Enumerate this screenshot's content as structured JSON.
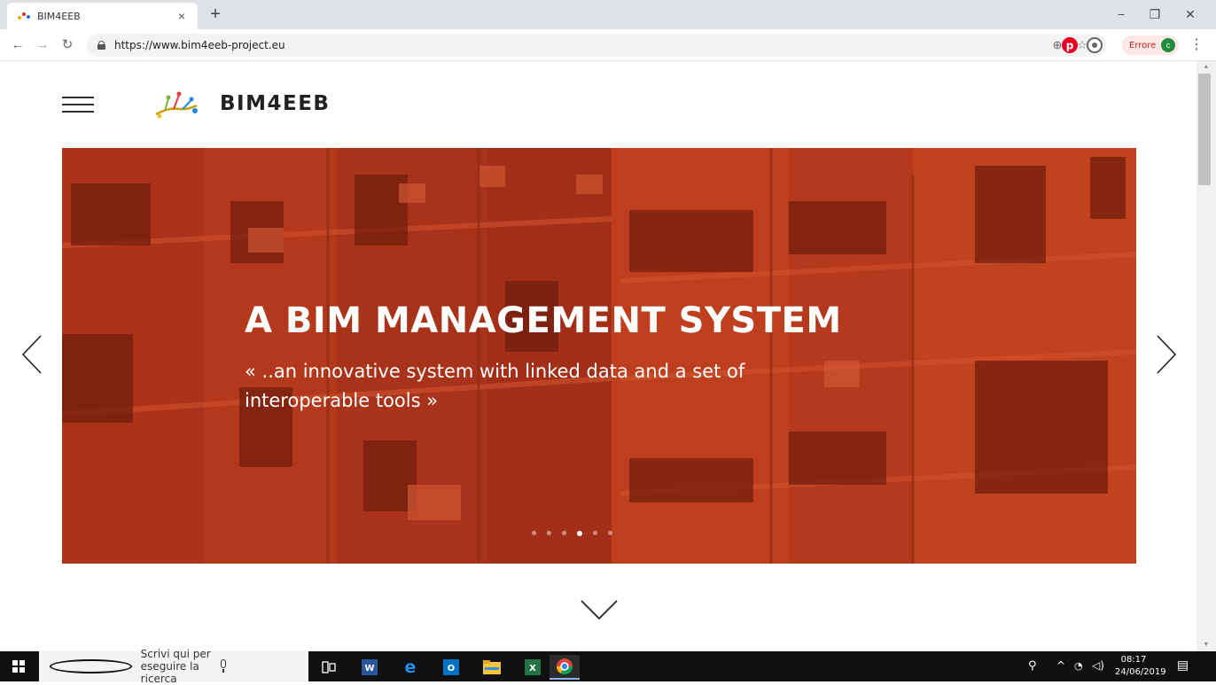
{
  "browser": {
    "tab_title": "BIM4EEB",
    "tab_close": "×",
    "new_tab": "+",
    "url": "https://www.bim4eeb-project.eu",
    "profile_status": "Errore",
    "profile_initial": "c",
    "window_controls": {
      "minimize": "−",
      "restore": "❐",
      "close": "✕"
    }
  },
  "site": {
    "name": "BIM4EEB",
    "hero": {
      "title": "A BIM MANAGEMENT SYSTEM",
      "subtitle": "« ..an innovative system with linked data and a set of interoperable tools »",
      "slide_count": 6,
      "active_slide_index": 3
    },
    "colors": {
      "hero_overlay": "#b8391a",
      "text": "#222222"
    }
  },
  "taskbar": {
    "search_placeholder": "Scrivi qui per eseguire la ricerca",
    "apps": [
      "task-view",
      "word",
      "edge",
      "outlook",
      "file-explorer",
      "excel",
      "chrome"
    ],
    "clock_time": "08:17",
    "clock_date": "24/06/2019"
  }
}
